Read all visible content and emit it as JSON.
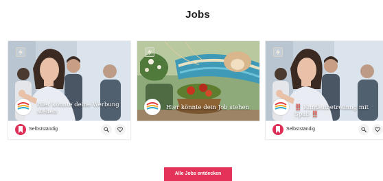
{
  "page": {
    "title": "Jobs"
  },
  "cards": [
    {
      "caption": "Hier könnte deine Werbung stehen",
      "type": "Selbstständig"
    },
    {
      "caption": "Hier könnte dein Job stehen"
    },
    {
      "caption": "‼️ Kundenbetreuung mit Spaß ‼️",
      "type": "Selbstständig"
    }
  ],
  "cta": {
    "label": "Alle Jobs entdecken"
  },
  "colors": {
    "accent": "#e33358",
    "pin": "#de2f57"
  },
  "icons": [
    "flash-icon",
    "company-logo",
    "bookmark-icon",
    "zoom-icon",
    "heart-icon"
  ]
}
